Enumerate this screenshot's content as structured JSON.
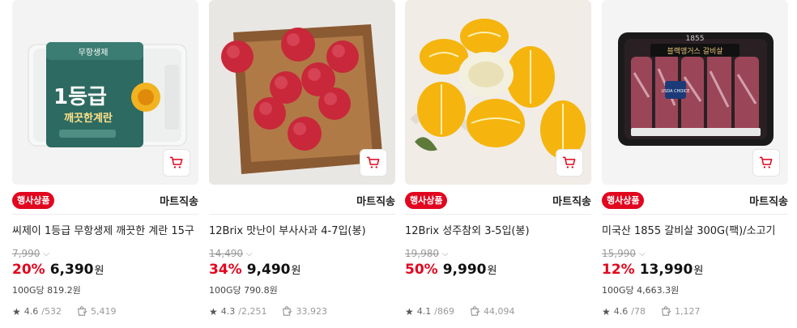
{
  "products": [
    {
      "badge": "행사상품",
      "shipping": "마트직송",
      "title": "씨제이 1등급 무항생제 깨끗한 계란 15구",
      "original_price": "7,990",
      "discount": "20%",
      "price": "6,390",
      "currency": "원",
      "unit_price": "100G당 819.2원",
      "rating": "4.6",
      "reviews": "/532",
      "purchases": "5,419",
      "package_text": {
        "big": "1등급",
        "sub": "깨끗한계란",
        "top": "무항생제"
      }
    },
    {
      "badge": "",
      "shipping": "마트직송",
      "title": "12Brix 맛난이 부사사과 4-7입(봉)",
      "original_price": "14,490",
      "discount": "34%",
      "price": "9,490",
      "currency": "원",
      "unit_price": "100G당 790.8원",
      "rating": "4.3",
      "reviews": "/2,251",
      "purchases": "33,923"
    },
    {
      "badge": "행사상품",
      "shipping": "마트직송",
      "title": "12Brix 성주참외 3-5입(봉)",
      "original_price": "19,980",
      "discount": "50%",
      "price": "9,990",
      "currency": "원",
      "unit_price": "",
      "rating": "4.1",
      "reviews": "/869",
      "purchases": "44,094"
    },
    {
      "badge": "행사상품",
      "shipping": "마트직송",
      "title": "미국산 1855 갈비살 300G(팩)/소고기",
      "original_price": "15,990",
      "discount": "12%",
      "price": "13,990",
      "currency": "원",
      "unit_price": "100G당 4,663.3원",
      "rating": "4.6",
      "reviews": "/78",
      "purchases": "1,127",
      "package_text": {
        "brand": "1855",
        "label": "블랙앵거스 갈비살",
        "usda": "USDA CHOICE"
      }
    }
  ],
  "icons": {
    "cart": "cart-icon",
    "star": "star-icon",
    "purchase": "shopping-bag-icon",
    "chevron": "chevron-down-icon"
  },
  "colors": {
    "accent": "#e1061e",
    "muted": "#999999"
  }
}
